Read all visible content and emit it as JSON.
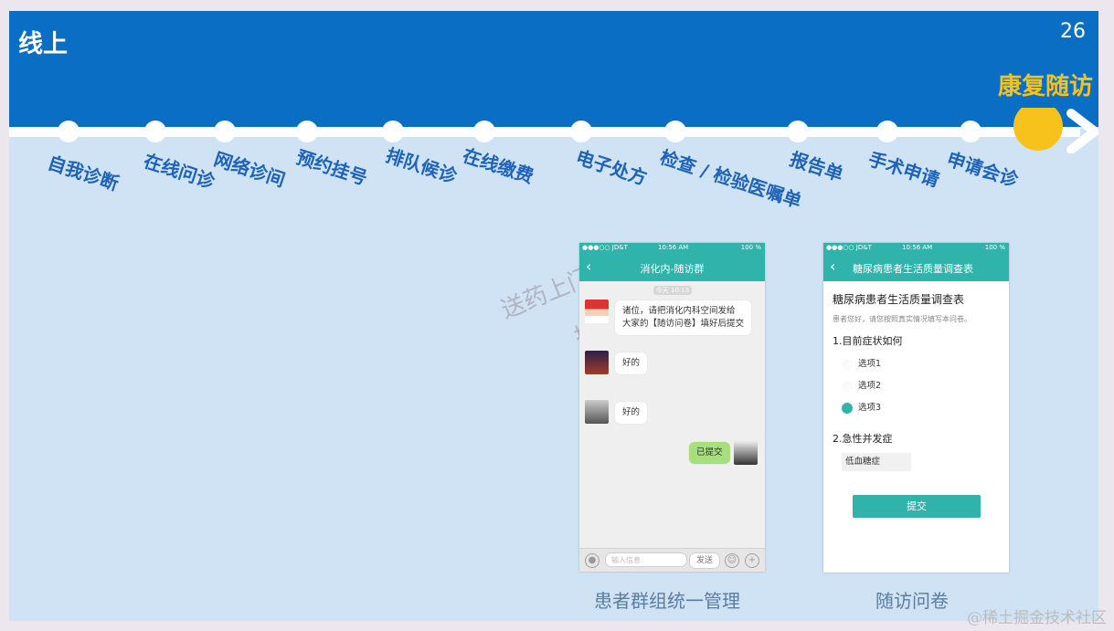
{
  "slide": {
    "section_title": "线上",
    "page_number": "26",
    "highlight_stage": "康复随访",
    "accent_color": "#f6c21b",
    "banner_color": "#0a6fc4"
  },
  "timeline": {
    "stages": [
      "自我诊断",
      "在线问诊",
      "网络诊间",
      "预约挂号",
      "排队候诊",
      "在线缴费",
      "电子处方",
      "检查 / 检验医嘱单",
      "报告单",
      "手术申请",
      "申请会诊"
    ]
  },
  "watermark": {
    "line1": "送药上门",
    "line2": "护"
  },
  "chat_screen": {
    "status_carrier": "●●●○○ JD&T",
    "status_time": "10:56 AM",
    "status_battery": "100 %",
    "title": "消化内-随访群",
    "time_chip": "今天 10:13",
    "messages": [
      {
        "text_line1": "诸位，请把消化内科空间发给",
        "text_line2": "大家的【随访问卷】填好后提交"
      },
      {
        "text": "好的"
      },
      {
        "text": "好的"
      },
      {
        "text": "已提交"
      }
    ],
    "input_placeholder": "输入信息",
    "send_label": "发送",
    "caption": "患者群组统一管理"
  },
  "survey_screen": {
    "status_carrier": "●●●○○ JD&T",
    "status_time": "10:56 AM",
    "status_battery": "100 %",
    "nav_title": "糖尿病患者生活质量调查表",
    "form_title": "糖尿病患者生活质量调查表",
    "hint": "患者您好，请您按照真实情况填写本问卷。",
    "q1": "1.目前症状如何",
    "options": [
      "选项1",
      "选项2",
      "选项3"
    ],
    "selected_option": 2,
    "q2": "2.急性并发症",
    "q2_answer": "低血糖症",
    "submit_label": "提交",
    "caption": "随访问卷"
  },
  "site_mark": "@稀土掘金技术社区"
}
